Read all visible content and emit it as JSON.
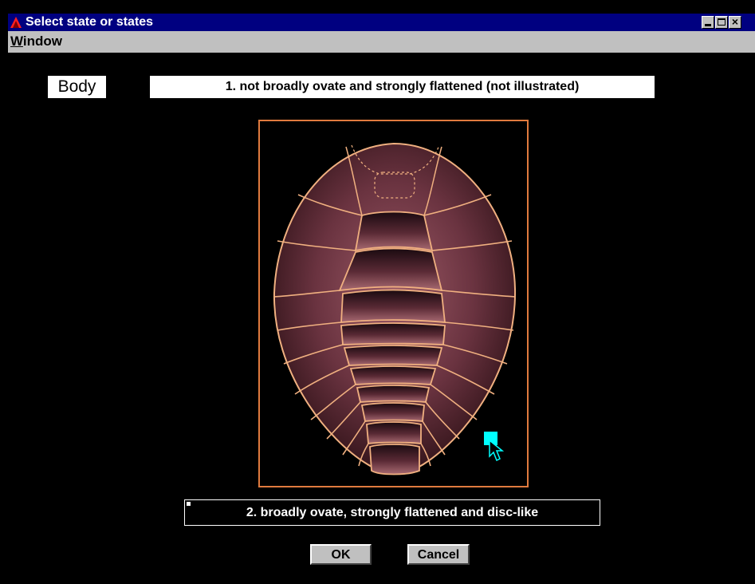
{
  "window": {
    "title": "Select state or states",
    "menu": [
      {
        "label": "Window",
        "mnemonic": "W",
        "rest": "indow"
      }
    ]
  },
  "character": {
    "label": "Body"
  },
  "states": [
    {
      "label": "1. not broadly ovate and strongly flattened (not illustrated)",
      "selected": false
    },
    {
      "label": "2. broadly ovate, strongly flattened and disc-like",
      "selected": true
    }
  ],
  "buttons": {
    "ok": "OK",
    "cancel": "Cancel"
  },
  "icons": {
    "app": "app-logo-icon",
    "minimize": "minimize-icon",
    "maximize": "maximize-icon",
    "close": "close-icon",
    "cursor": "mouse-cursor-icon"
  },
  "colors": {
    "titlebar": "#000080",
    "frame_border": "#e07a3e",
    "body_fill_dark": "#2a0f14",
    "body_fill_light": "#8a4a55",
    "segment_lines": "#f0b080",
    "cursor_cyan": "#00ffff"
  }
}
